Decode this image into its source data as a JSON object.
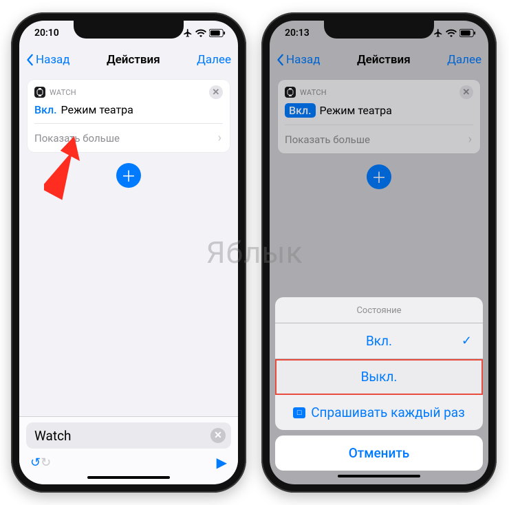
{
  "watermark": "Яблык",
  "left": {
    "status": {
      "time": "20:10"
    },
    "nav": {
      "back": "Назад",
      "title": "Действия",
      "next": "Далее"
    },
    "card": {
      "app": "WATCH",
      "toggle": "Вкл.",
      "mode": "Режим театра",
      "more": "Показать больше"
    },
    "search": {
      "value": "Watch"
    }
  },
  "right": {
    "status": {
      "time": "20:13"
    },
    "nav": {
      "back": "Назад",
      "title": "Действия",
      "next": "Далее"
    },
    "card": {
      "app": "WATCH",
      "toggle": "Вкл.",
      "mode": "Режим театра",
      "more": "Показать больше"
    },
    "sheet": {
      "title": "Состояние",
      "on": "Вкл.",
      "off": "Выкл.",
      "ask": "Спрашивать каждый раз",
      "cancel": "Отменить"
    }
  }
}
